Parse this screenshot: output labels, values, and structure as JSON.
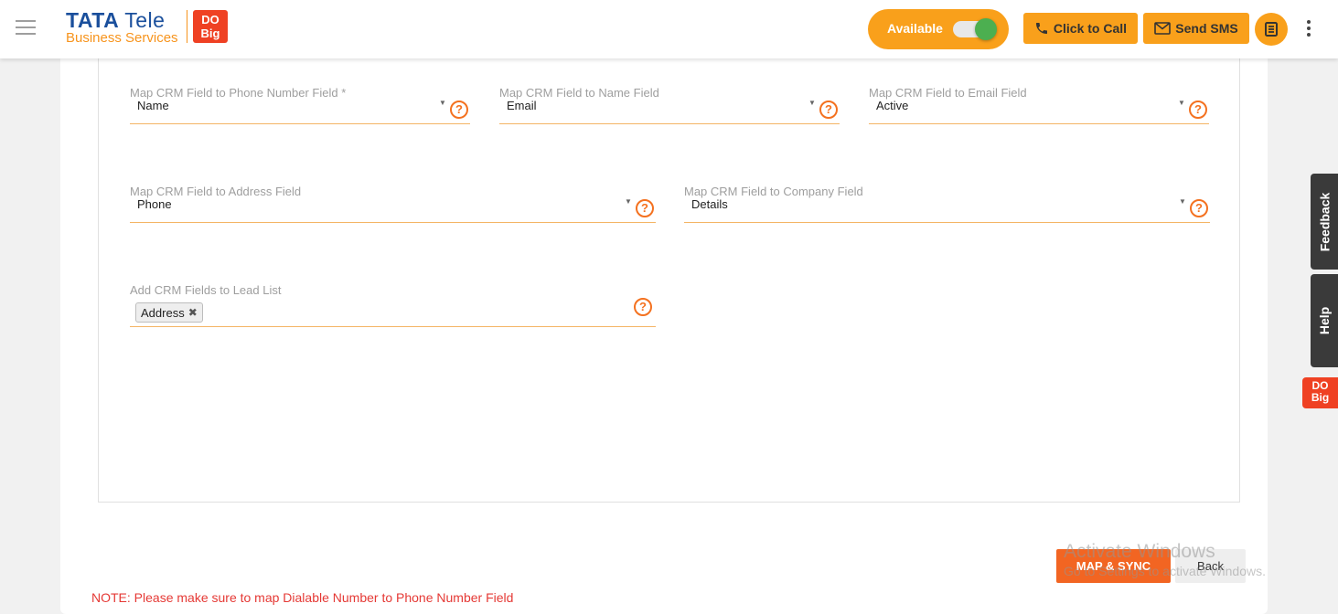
{
  "header": {
    "logo_brand": "TATA",
    "logo_product": "Tele",
    "logo_subtitle": "Business Services",
    "logo_badge": "DO Big",
    "status_label": "Available",
    "status_on": true,
    "click_to_call_label": "Click to Call",
    "send_sms_label": "Send SMS",
    "icons": [
      "menu-icon",
      "phone-icon",
      "mail-icon",
      "book-icon",
      "more-vertical-icon"
    ]
  },
  "form": {
    "phone_field": {
      "label": "Map CRM Field to Phone Number Field *",
      "value": "Name"
    },
    "name_field": {
      "label": "Map CRM Field to Name Field",
      "value": "Email"
    },
    "email_field": {
      "label": "Map CRM Field to Email Field",
      "value": "Active"
    },
    "address_field": {
      "label": "Map CRM Field to Address Field",
      "value": "Phone"
    },
    "company_field": {
      "label": "Map CRM Field to Company Field",
      "value": "Details"
    },
    "lead_list": {
      "label": "Add CRM Fields to Lead List",
      "chips": [
        "Address"
      ]
    }
  },
  "actions": {
    "map_sync_label": "MAP & SYNC",
    "back_label": "Back"
  },
  "note": "NOTE: Please make sure to map Dialable Number to Phone Number Field",
  "side_tabs": {
    "feedback_label": "Feedback",
    "help_label": "Help",
    "badge": "DO Big"
  },
  "watermark": {
    "line1": "Activate Windows",
    "line2": "Go to Settings to activate Windows."
  },
  "colors": {
    "accent": "#f9a01b",
    "primary_button": "#f26522",
    "note_text": "#e53935",
    "field_underline": "#f4b565",
    "help_icon": "#f4711f",
    "toggle_on": "#4caf50"
  }
}
